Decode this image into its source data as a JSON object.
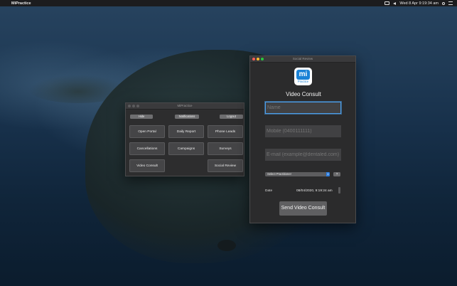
{
  "menubar": {
    "apple": "",
    "app_name": "MiPractice",
    "datetime": "Wed 8 Apr  9:19:34 am"
  },
  "mipractice_window": {
    "title": "MiPractice",
    "top_buttons": [
      "Hide",
      "Notifications",
      "Logout"
    ],
    "grid_buttons": [
      "Open Portal",
      "Daily Report",
      "Phone Leads",
      "Cancellations",
      "Campaigns",
      "Surveys",
      "Video Consult",
      "Social Review"
    ]
  },
  "social_review_window": {
    "title": "Social Review",
    "logo_text": "mi",
    "logo_tag": "Practice",
    "heading": "Video Consult",
    "name_placeholder": "Name",
    "mobile_placeholder": "Mobile (0400111111)",
    "email_placeholder": "E-mail (example@dentaled.com)",
    "practitioner_select": "Select Practitioner",
    "help_button": "?",
    "date_label": "Date",
    "date_value": "08/04/2020,  9:19:24 am",
    "send_button": "Send Video Consult"
  },
  "colors": {
    "close": "#ff5f57",
    "minimize": "#febc2e",
    "zoom": "#28c840",
    "inactive_light": "#5b5b5d",
    "accent": "#2f7fe0",
    "brand": "#1a82d6"
  }
}
